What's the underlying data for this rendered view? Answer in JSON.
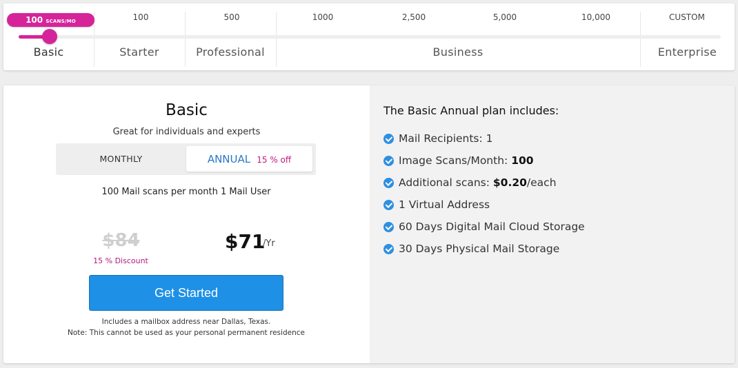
{
  "slider": {
    "badge_value": "100",
    "badge_unit": "SCANS/MO",
    "ticks": [
      "100",
      "500",
      "1000",
      "2,500",
      "5,000",
      "10,000",
      "CUSTOM"
    ],
    "tiers": [
      "Basic",
      "Starter",
      "Professional",
      "Business",
      "Enterprise"
    ],
    "selected_tier": "Basic",
    "accent_color": "#d6239a"
  },
  "plan": {
    "title": "Basic",
    "subtitle": "Great for individuals and experts",
    "toggle": {
      "monthly_label": "MONTHLY",
      "annual_label": "ANNUAL",
      "annual_discount": "15 % off",
      "selected": "annual"
    },
    "scans_desc": "100 Mail scans per month 1 Mail User",
    "old_price": "$84",
    "discount_label": "15 % Discount",
    "new_price": "$71",
    "price_period": "/Yr",
    "cta_label": "Get Started",
    "fineprint_1": "Includes a mailbox address near Dallas, Texas.",
    "fineprint_2": "Note: This cannot be used as your personal permanent residence"
  },
  "includes": {
    "title": "The Basic Annual plan includes:",
    "features": [
      {
        "text": "Mail Recipients: 1",
        "bold": ""
      },
      {
        "text": "Image Scans/Month: ",
        "bold": "100"
      },
      {
        "text": "Additional scans: ",
        "bold": "$0.20",
        "suffix": "/each"
      },
      {
        "text": "1 Virtual Address",
        "bold": ""
      },
      {
        "text": "60 Days Digital Mail Cloud Storage",
        "bold": ""
      },
      {
        "text": "30 Days Physical Mail Storage",
        "bold": ""
      }
    ],
    "check_icon": "check-circle-icon",
    "check_color": "#2f8fe0"
  }
}
